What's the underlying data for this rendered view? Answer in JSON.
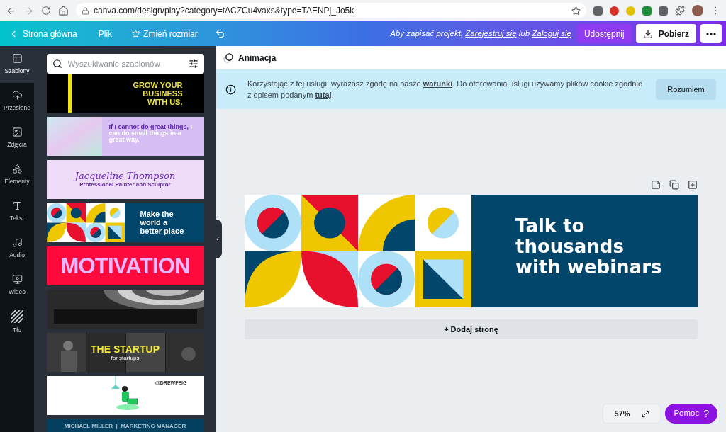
{
  "browser": {
    "url": "canva.com/design/play?category=tACZCu4vaxs&type=TAENPj_Jo5k"
  },
  "toolbar": {
    "home": "Strona główna",
    "file": "Plik",
    "resize": "Zmień rozmiar",
    "save_prompt": {
      "before": "Aby zapisać projekt,",
      "register": "Zarejestruj się",
      "middle": "lub",
      "login": "Zaloguj się"
    },
    "share": "Udostępnij",
    "download": "Pobierz"
  },
  "rail": [
    {
      "label": "Szablony",
      "selected": true
    },
    {
      "label": "Przesłane",
      "selected": false
    },
    {
      "label": "Zdjęcia",
      "selected": false
    },
    {
      "label": "Elementy",
      "selected": false
    },
    {
      "label": "Tekst",
      "selected": false
    },
    {
      "label": "Audio",
      "selected": false
    },
    {
      "label": "Wideo",
      "selected": false
    },
    {
      "label": "Tło",
      "selected": false
    }
  ],
  "search": {
    "placeholder": "Wyszukiwanie szablonów"
  },
  "templates": [
    {
      "kind": "business",
      "lines": [
        "GROW YOUR",
        "BUSINESS",
        "WITH US."
      ]
    },
    {
      "kind": "quote",
      "highlight": "If I cannot do great things,",
      "rest": "I can do small things in a great way."
    },
    {
      "kind": "script",
      "lines": [
        "Jacqueline Thompson",
        "Professional Painter and Sculptor"
      ]
    },
    {
      "kind": "geometric",
      "lines": [
        "Make the",
        "world a",
        "better place"
      ]
    },
    {
      "kind": "motivation",
      "lines": [
        "MOTIVATION"
      ]
    },
    {
      "kind": "architecture"
    },
    {
      "kind": "startup",
      "lines": [
        "THE STARTUP",
        "for startups"
      ]
    },
    {
      "kind": "illustration",
      "lines": [
        "@DREWFEIG"
      ]
    },
    {
      "kind": "profile",
      "lines": [
        "MICHAEL MILLER  |  MARKETING MANAGER"
      ]
    }
  ],
  "editor": {
    "animation": "Animacja",
    "notice": {
      "before": "Korzystając z tej usługi, wyrażasz zgodę na nasze",
      "terms_link": "warunki",
      "middle": ". Do oferowania usługi używamy plików cookie zgodnie z opisem podanym",
      "here_link": "tutaj",
      "after": ".",
      "button": "Rozumiem"
    },
    "design": {
      "lines": [
        "Talk to",
        "thousands",
        "with webinars"
      ]
    },
    "add_page": "+ Dodaj stronę",
    "zoom": "57%",
    "help": {
      "label": "Pomoc",
      "mark": "?"
    }
  }
}
